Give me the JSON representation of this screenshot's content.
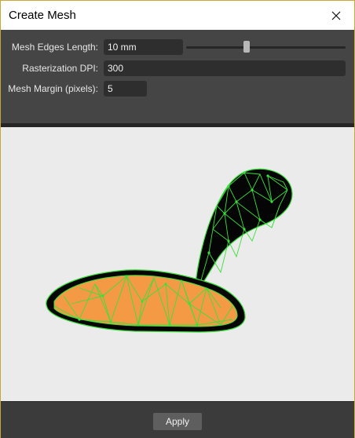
{
  "window": {
    "title": "Create Mesh"
  },
  "controls": {
    "edges": {
      "label": "Mesh Edges Length:",
      "value": "10 mm",
      "slider_fraction": 0.38
    },
    "dpi": {
      "label": "Rasterization DPI:",
      "value": "300"
    },
    "margin": {
      "label": "Mesh Margin (pixels):",
      "value": "5"
    }
  },
  "footer": {
    "apply_label": "Apply"
  },
  "colors": {
    "mesh_line": "#3be03b",
    "shape_fill_orange": "#f59a44",
    "shape_fill_black": "#050505",
    "canvas_bg": "#ebebeb"
  },
  "icons": {
    "close": "close-icon"
  }
}
